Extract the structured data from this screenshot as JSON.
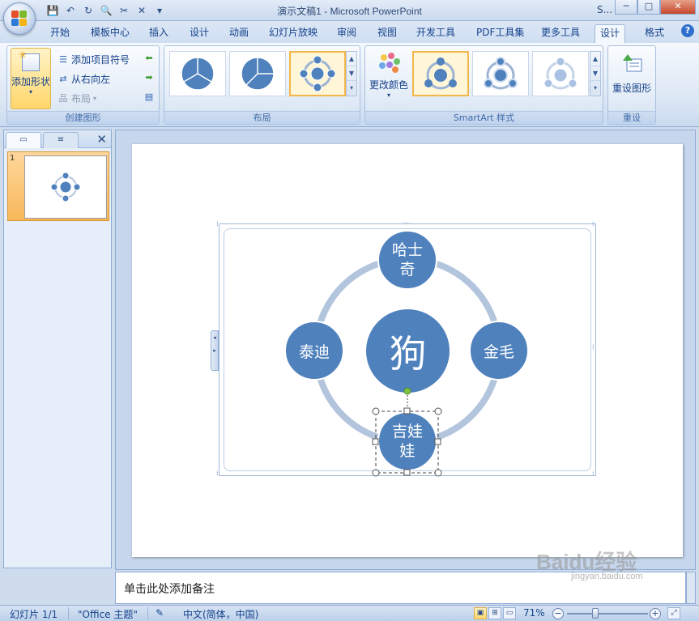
{
  "window": {
    "title": "演示文稿1 - Microsoft PowerPoint",
    "title_suffix": "S...",
    "controls": {
      "minimize": "─",
      "maximize": "□",
      "close": "✕"
    }
  },
  "quick_access": {
    "save": "💾",
    "undo": "↶",
    "redo": "↻",
    "preview": "🔍",
    "cut": "✂",
    "close": "✕",
    "dropdown": "▾"
  },
  "tabs": [
    "开始",
    "模板中心",
    "插入",
    "设计",
    "动画",
    "幻灯片放映",
    "审阅",
    "视图",
    "开发工具",
    "PDF工具集",
    "更多工具",
    "设计",
    "格式"
  ],
  "active_tab_index": 11,
  "ribbon": {
    "create_graphic": {
      "label": "创建图形",
      "add_shape": "添加形状",
      "add_bullet": "添加项目符号",
      "right_to_left": "从右向左",
      "layout": "布局"
    },
    "layouts": {
      "label": "布局"
    },
    "smartart_styles": {
      "label": "SmartArt 样式",
      "change_colors": "更改颜色"
    },
    "reset": {
      "label": "重设",
      "reset_graphic": "重设图形"
    }
  },
  "left_panel": {
    "tab_slides": "▭",
    "tab_outline": "≡",
    "close": "✕",
    "slide_number": "1"
  },
  "smartart": {
    "center": "狗",
    "top": "哈士奇",
    "right": "金毛",
    "bottom": "吉娃娃",
    "left": "泰迪",
    "colors": {
      "node": "#4f81bd",
      "ring": "#b3c4dd"
    }
  },
  "notes": {
    "placeholder": "单击此处添加备注"
  },
  "status_bar": {
    "slide_info": "幻灯片 1/1",
    "theme": "\"Office 主题\"",
    "language": "中文(简体，中国)",
    "zoom": "71%"
  },
  "watermark": {
    "text": "Baidu经验",
    "sub": "jingyan.baidu.com"
  }
}
